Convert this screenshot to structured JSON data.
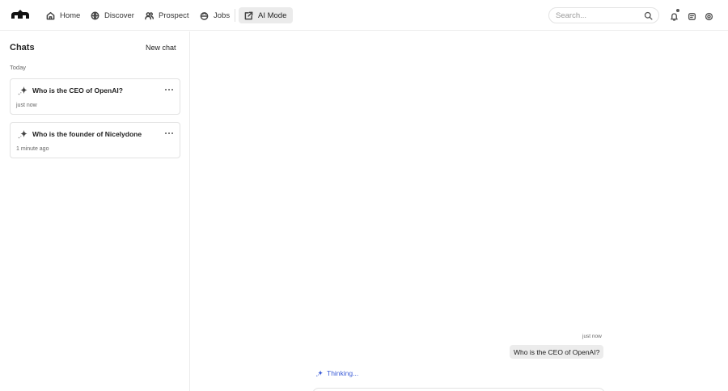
{
  "nav": {
    "items": [
      {
        "label": "Home",
        "icon": "home-icon",
        "active": false
      },
      {
        "label": "Discover",
        "icon": "globe-icon",
        "active": false
      },
      {
        "label": "Prospect",
        "icon": "users-icon",
        "active": false
      },
      {
        "label": "Jobs",
        "icon": "briefcase-icon",
        "active": false
      },
      {
        "label": "AI Mode",
        "icon": "ai-mode-icon",
        "active": true
      }
    ],
    "search_placeholder": "Search..."
  },
  "sidebar": {
    "title": "Chats",
    "new_chat_label": "New chat",
    "section_label": "Today",
    "chats": [
      {
        "title": "Who is the CEO of OpenAI?",
        "time": "just now"
      },
      {
        "title": "Who is the founder of Nicelydone",
        "time": "1 minute ago"
      }
    ]
  },
  "conversation": {
    "messages": [
      {
        "role": "user",
        "text": "Who is the CEO of OpenAI?",
        "time": "just now"
      }
    ],
    "status_text": "Thinking..."
  },
  "colors": {
    "accent": "#3a5bd6",
    "active_nav_bg": "#ebebeb",
    "user_bubble_bg": "#ececec"
  }
}
